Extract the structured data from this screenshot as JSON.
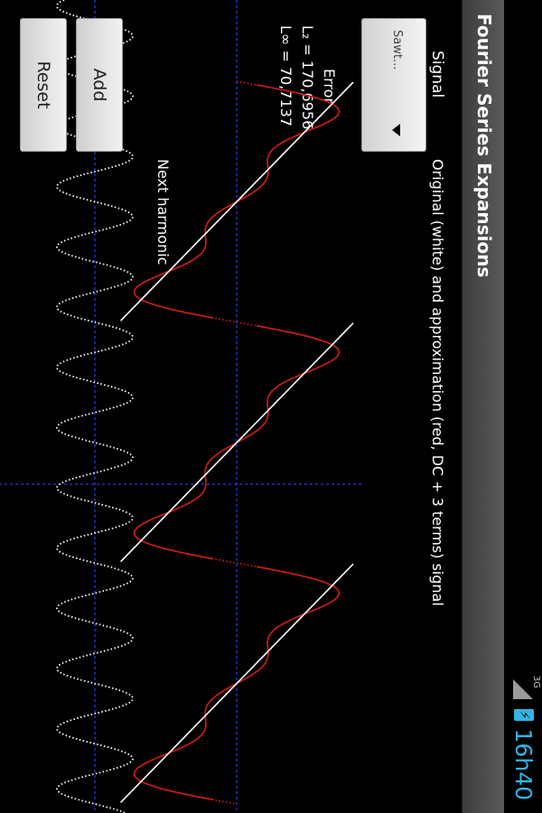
{
  "status": {
    "network": "3G",
    "clock": "16h40"
  },
  "app": {
    "title": "Fourier Series Expansions"
  },
  "controls": {
    "signal_label": "Signal",
    "selected_signal": "Sawt...",
    "add_label": "Add",
    "reset_label": "Reset"
  },
  "error": {
    "title": "Error",
    "l2": "L₂ = 170,6956",
    "linf": "L∞ = 70,7137"
  },
  "plot": {
    "caption": "Original (white) and approximation (red, DC + 3 terms) signal",
    "harmonic_caption": "Next harmonic"
  },
  "chart_data": {
    "type": "line",
    "signal": "Sawtooth",
    "approximation_terms": 3,
    "next_harmonic_index": 4,
    "periods_shown": 3,
    "colors": {
      "original": "#ffffff",
      "approximation": "#cc1b1b",
      "axis": "#2b3bd6",
      "harmonic": "#ffffff"
    }
  }
}
